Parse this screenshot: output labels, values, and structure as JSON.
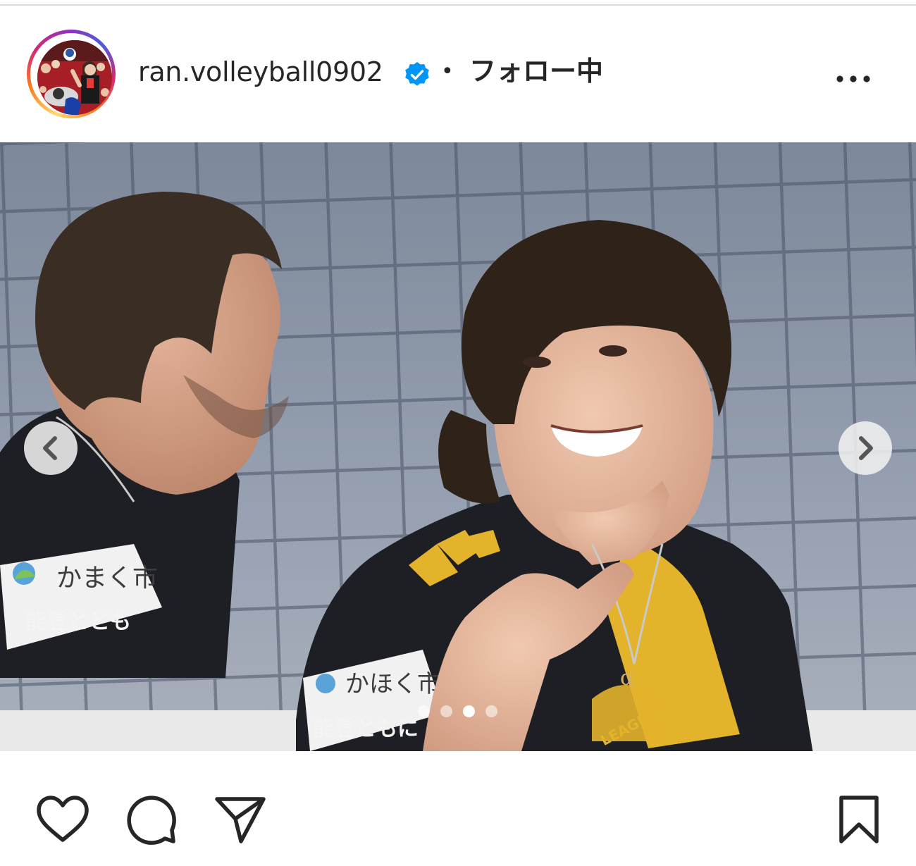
{
  "post": {
    "username": "ran.volleyball0902",
    "verified": true,
    "separator": "•",
    "follow_status": "フォロー中",
    "more_label": "More options"
  },
  "carousel": {
    "slide_count": 4,
    "active_index": 2
  },
  "photo": {
    "sleeve_text_left": "かまく市",
    "sleeve_text_left_2": "能登ととも",
    "sleeve_text_right": "かほく市",
    "sleeve_text_right_2": "能登ともに",
    "league_badge_text": "LEAGUE"
  },
  "actions": {
    "like": "heart-icon",
    "comment": "comment-icon",
    "share": "share-icon",
    "save": "bookmark-icon"
  },
  "colors": {
    "text": "#262626",
    "verified_blue": "#0095f6",
    "jersey_gold": "#e3b32b",
    "jersey_black": "#1d1f24",
    "net_bg": "#8d97a8"
  }
}
